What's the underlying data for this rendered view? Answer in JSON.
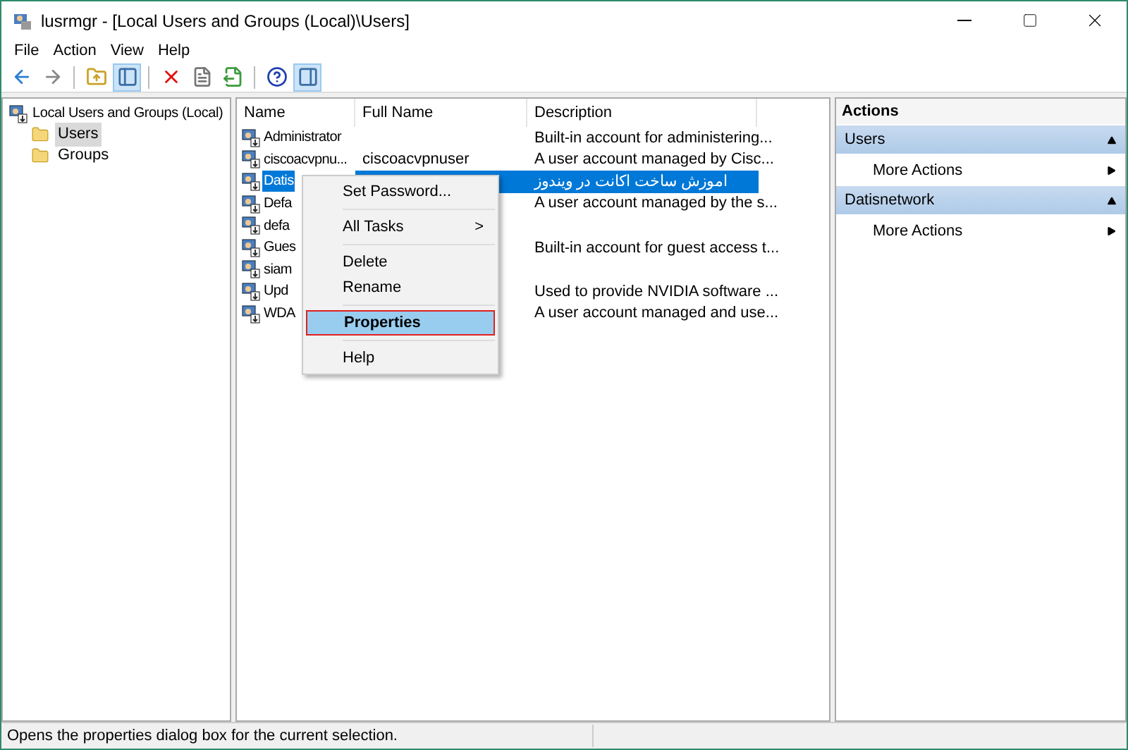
{
  "window": {
    "title": "lusrmgr - [Local Users and Groups (Local)\\Users]"
  },
  "menu": [
    "File",
    "Action",
    "View",
    "Help"
  ],
  "toolbar": [
    {
      "kind": "back",
      "pressed": false
    },
    {
      "kind": "forward",
      "pressed": false
    },
    {
      "kind": "sep"
    },
    {
      "kind": "up",
      "pressed": false
    },
    {
      "kind": "tree",
      "pressed": true
    },
    {
      "kind": "sep"
    },
    {
      "kind": "delete",
      "pressed": false
    },
    {
      "kind": "properties",
      "pressed": false
    },
    {
      "kind": "export",
      "pressed": false
    },
    {
      "kind": "sep"
    },
    {
      "kind": "help",
      "pressed": false
    },
    {
      "kind": "actionpane",
      "pressed": true
    }
  ],
  "tree": {
    "label": "Local Users and Groups (Local)",
    "children": [
      {
        "label": "Users",
        "selected": true
      },
      {
        "label": "Groups",
        "selected": false
      }
    ]
  },
  "table": {
    "columns": [
      "Name",
      "Full Name",
      "Description"
    ],
    "rows": [
      {
        "name": "Administrator",
        "full_name": "",
        "description": "Built-in account for administering...",
        "selected": false
      },
      {
        "name": "ciscoacvpnu...",
        "full_name": "ciscoacvpnuser",
        "description": "A user account managed by Cisc...",
        "selected": false
      },
      {
        "name": "Datis",
        "full_name": "",
        "description": "اموزش ساخت اکانت در ویندوز",
        "selected": true
      },
      {
        "name": "Defa",
        "full_name": "",
        "description": "A user account managed by the s...",
        "selected": false
      },
      {
        "name": "defa",
        "full_name": "",
        "description": "",
        "selected": false
      },
      {
        "name": "Gues",
        "full_name": "",
        "description": "Built-in account for guest access t...",
        "selected": false
      },
      {
        "name": "siam",
        "full_name": "",
        "description": "",
        "selected": false
      },
      {
        "name": "Upd",
        "full_name": "",
        "description": "Used to provide NVIDIA software ...",
        "selected": false
      },
      {
        "name": "WDA",
        "full_name": "",
        "description": "A user account managed and use...",
        "selected": false
      }
    ]
  },
  "context_menu": [
    {
      "label": "Set Password...",
      "kind": "item",
      "selected": false
    },
    {
      "kind": "sep"
    },
    {
      "label": "All Tasks",
      "kind": "submenu",
      "selected": false
    },
    {
      "kind": "sep"
    },
    {
      "label": "Delete",
      "kind": "item",
      "selected": false
    },
    {
      "label": "Rename",
      "kind": "item",
      "selected": false
    },
    {
      "kind": "sep"
    },
    {
      "label": "Properties",
      "kind": "item",
      "selected": true
    },
    {
      "kind": "sep"
    },
    {
      "label": "Help",
      "kind": "item",
      "selected": false
    }
  ],
  "submenu_arrow": ">",
  "actions": {
    "title": "Actions",
    "sections": [
      {
        "title": "Users",
        "items": [
          "More Actions"
        ]
      },
      {
        "title": "Datisnetwork",
        "items": [
          "More Actions"
        ]
      }
    ]
  },
  "status_bar": "Opens the properties dialog box for the current selection."
}
